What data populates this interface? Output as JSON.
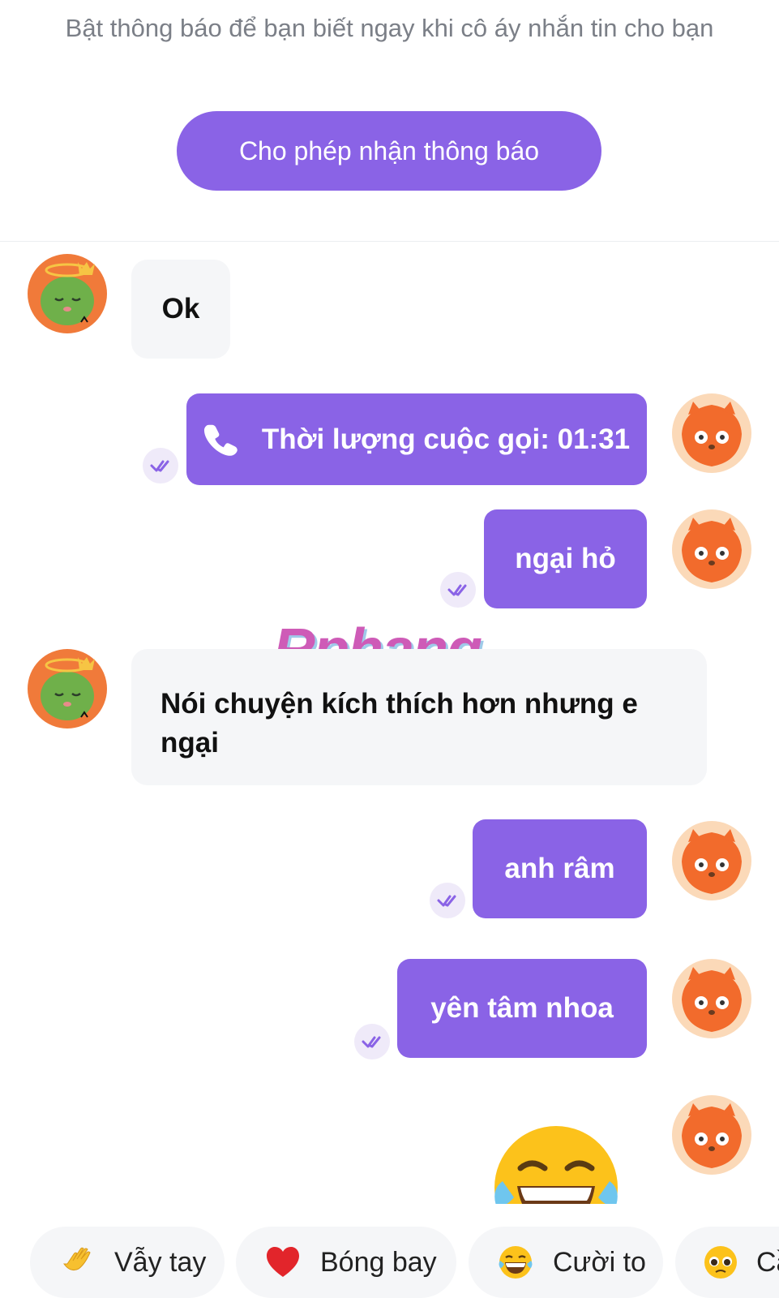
{
  "notification": {
    "text": "Bật thông báo để bạn biết ngay khi cô áy nhắn tin cho bạn",
    "button_label": "Cho phép nhận thông báo"
  },
  "messages": [
    {
      "from": "them",
      "text": "Ok"
    },
    {
      "from": "me",
      "type": "call",
      "text": "Thời lượng cuộc gọi: 01:31",
      "icon": "phone-icon",
      "status": "read"
    },
    {
      "from": "me",
      "text": "ngại hỏ",
      "status": "read"
    },
    {
      "from": "them",
      "text": "Nói chuyện kích thích hơn nhưng e ngại"
    },
    {
      "from": "me",
      "text": "anh râm",
      "status": "read"
    },
    {
      "from": "me",
      "text": "yên tâm nhoa",
      "status": "read"
    },
    {
      "from": "me",
      "type": "emoji",
      "icon": "laughing-tears-emoji"
    }
  ],
  "watermark": "Rphang",
  "quick_replies": [
    {
      "icon": "waving-hand-icon",
      "label": "Vẫy tay"
    },
    {
      "icon": "heart-icon",
      "label": "Bóng bay"
    },
    {
      "icon": "laughing-emoji-icon",
      "label": "Cười to"
    },
    {
      "icon": "pleading-emoji-icon",
      "label": "Cầ"
    }
  ],
  "colors": {
    "accent": "#8a63e6",
    "incoming_bubble": "#f5f6f8",
    "notice_text": "#7b7f87"
  }
}
